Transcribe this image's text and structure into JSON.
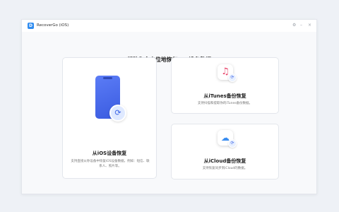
{
  "window": {
    "title": "RecoverGo (iOS)",
    "logo_letter": "D",
    "controls": {
      "settings_icon": "⚙",
      "minimize_icon": "–",
      "close_icon": "×"
    }
  },
  "heading": "帮助你全方位地恢复iOS设备数据",
  "options": {
    "ios": {
      "title": "从iOS设备恢复",
      "desc": "支持直接从你设备中恢复iOS设备数据，例如：短信、联系人、照片等。",
      "icon_glyph": "",
      "badge_glyph": "⟳"
    },
    "itunes": {
      "title": "从iTunes备份恢复",
      "desc": "支持扫描和提取你的iTunes备份数据。",
      "icon_glyph": "♫",
      "badge_glyph": "⟳"
    },
    "icloud": {
      "title": "从iCloud备份恢复",
      "desc": "支持恢复同步到iCloud的数据。",
      "icon_glyph": "☁",
      "badge_glyph": "⟳"
    }
  },
  "colors": {
    "accent": "#2f8cf0",
    "phone": "#4a6cf0"
  }
}
